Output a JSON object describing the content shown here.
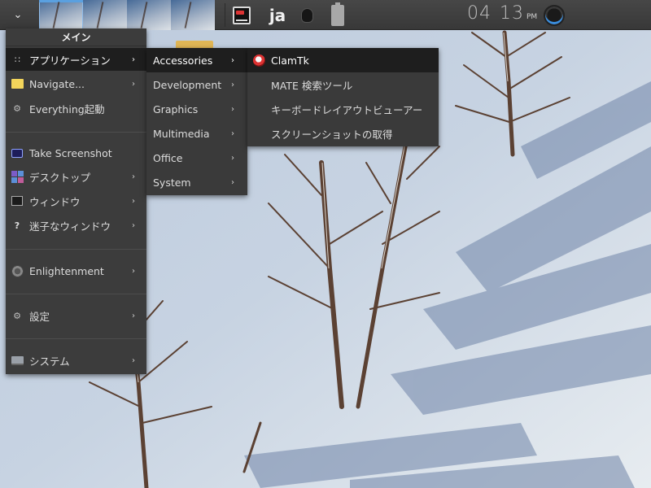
{
  "shelf": {
    "start_icon": "chevron-down-icon",
    "pager_count": 4,
    "terminal_icon": "terminal-icon",
    "lang": "ja",
    "bulb_icon": "lightbulb-icon",
    "battery_icon": "battery-icon",
    "clock_hour": "04",
    "clock_min": "13",
    "clock_ampm": "PM",
    "enlightenment_icon": "enlightenment-logo-icon"
  },
  "main_menu": {
    "title": "メイン",
    "items": [
      {
        "label": "アプリケーション",
        "icon": "apps-icon",
        "submenu": true
      },
      {
        "label": "Navigate...",
        "icon": "folder-icon",
        "submenu": true
      },
      {
        "label": "Everything起動",
        "icon": "gear-icon",
        "submenu": false
      },
      {
        "label": "Take Screenshot",
        "icon": "camera-icon",
        "submenu": false
      },
      {
        "label": "デスクトップ",
        "icon": "desktop-icon",
        "submenu": true
      },
      {
        "label": "ウィンドウ",
        "icon": "window-icon",
        "submenu": true
      },
      {
        "label": "迷子なウィンドウ",
        "icon": "lost-window-icon",
        "submenu": true
      },
      {
        "label": "Enlightenment",
        "icon": "enlightenment-icon",
        "submenu": true
      },
      {
        "label": "設定",
        "icon": "settings-icon",
        "submenu": true
      },
      {
        "label": "システム",
        "icon": "system-icon",
        "submenu": true
      }
    ]
  },
  "apps_menu": {
    "items": [
      {
        "label": "Accessories",
        "submenu": true
      },
      {
        "label": "Development",
        "submenu": true
      },
      {
        "label": "Graphics",
        "submenu": true
      },
      {
        "label": "Multimedia",
        "submenu": true
      },
      {
        "label": "Office",
        "submenu": true
      },
      {
        "label": "System",
        "submenu": true
      }
    ]
  },
  "accessories_menu": {
    "items": [
      {
        "label": "ClamTk",
        "icon": "clamtk-icon"
      },
      {
        "label": "MATE 検索ツール",
        "icon": ""
      },
      {
        "label": "キーボードレイアウトビューアー",
        "icon": ""
      },
      {
        "label": "スクリーンショットの取得",
        "icon": ""
      }
    ]
  },
  "arrow_glyph": "›",
  "colors": {
    "menu_bg": "#3c3c3c",
    "menu_selected": "#1e1e1e",
    "menu_text": "#dcdcdc",
    "shelf_bg": "#3f3f3f",
    "accent": "#5aa0e0"
  }
}
